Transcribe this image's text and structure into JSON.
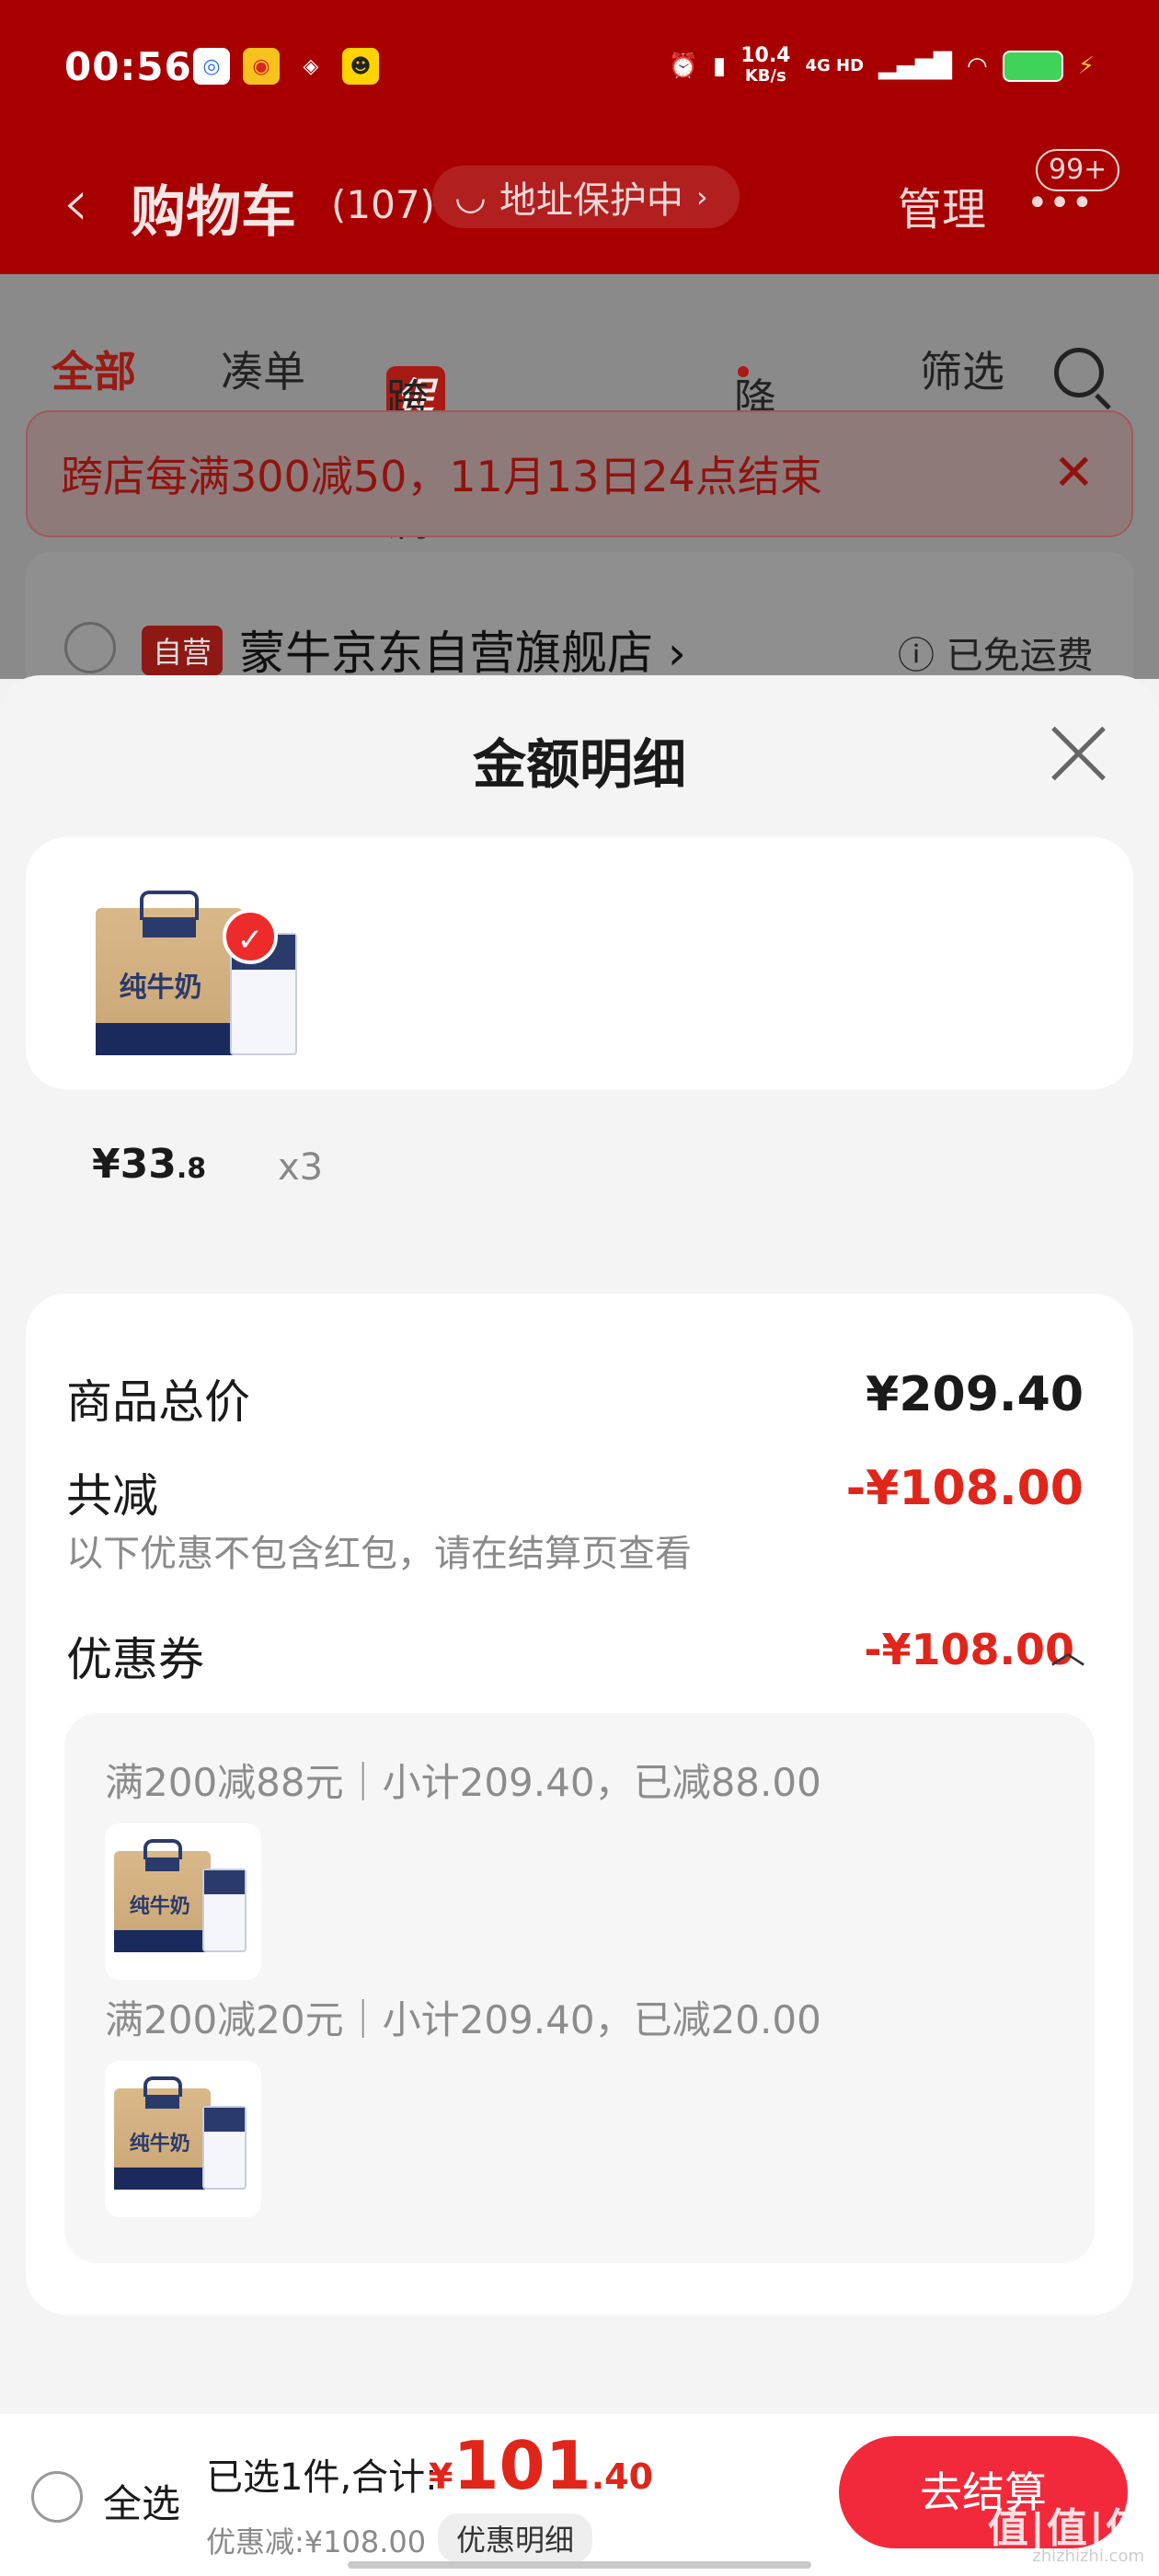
{
  "status_bar": {
    "time": "00:56",
    "speed": "10.4",
    "speed_unit": "KB/s",
    "network": "4G HD"
  },
  "header": {
    "back_icon": "chevron-left-icon",
    "title": "购物车",
    "count": "(107)",
    "address_protection": "地址保护中",
    "manage": "管理",
    "more_badge": "99+"
  },
  "filters": {
    "all": "全部",
    "bundle": "凑单",
    "promo_tag": "促",
    "cross_store": "跨店满减",
    "price_drop": "降价",
    "filter": "筛选"
  },
  "notice": {
    "text": "跨店每满300减50，11月13日24点结束"
  },
  "store": {
    "tag": "自营",
    "name": "蒙牛京东自营旗舰店",
    "shipping": "已免运费"
  },
  "sheet": {
    "title": "金额明细",
    "item": {
      "product_box_text": "纯牛奶",
      "price_int": "¥33",
      "price_dec": ".8",
      "quantity": "x3"
    },
    "goods_total_label": "商品总价",
    "goods_total_value": "¥209.40",
    "reduction_label": "共减",
    "reduction_value": "-¥108.00",
    "reduction_note": "以下优惠不包含红包，请在结算页查看",
    "coupon_label": "优惠券",
    "coupon_value": "-¥108.00",
    "coupons": [
      {
        "line": "满200减88元｜小计209.40，已减88.00"
      },
      {
        "line": "满200减20元｜小计209.40，已减20.00"
      }
    ]
  },
  "bottom_bar": {
    "select_all": "全选",
    "selected": "已选1件,合计:",
    "total_currency": "¥",
    "total_int": "101",
    "total_dec": ".40",
    "discount": "优惠减:¥108.00",
    "detail_button": "优惠明细",
    "checkout": "去结算"
  },
  "watermark": {
    "text": "值|值|值",
    "sub": "zhizhizhi.com"
  },
  "colors": {
    "header_red": "#a80000",
    "accent_red": "#e0251b",
    "checkout_red": "#f2293a"
  }
}
